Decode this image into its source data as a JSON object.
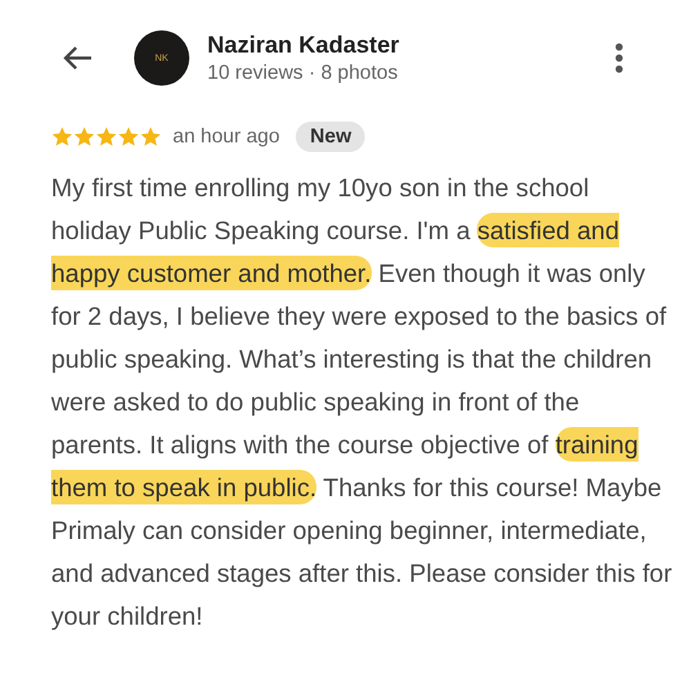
{
  "reviewer": {
    "avatar_text": "NK",
    "name": "Naziran Kadaster",
    "meta": "10 reviews · 8 photos"
  },
  "review": {
    "stars": 5,
    "time": "an hour ago",
    "badge": "New",
    "segments": [
      {
        "text": "My first time enrolling my 10yo son in the school holiday Public Speaking course. I'm a ",
        "highlighted": false
      },
      {
        "text": "satisfied and happy customer and mother.",
        "highlighted": true
      },
      {
        "text": " Even though it was only for 2 days, I believe they were exposed to the basics of public speaking. What’s interesting is that the children were asked to do public speaking in front of the parents. It aligns with the course objective of ",
        "highlighted": false
      },
      {
        "text": " training them to speak in public.",
        "highlighted": true
      },
      {
        "text": " Thanks for this course! Maybe Primaly can consider opening beginner, intermediate, and advanced stages after this. Please consider this for your children!",
        "highlighted": false
      }
    ]
  }
}
